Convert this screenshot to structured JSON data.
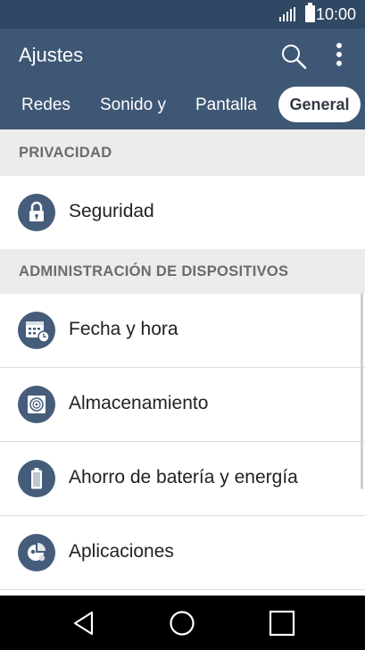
{
  "status": {
    "time": "10:00"
  },
  "app_bar": {
    "title": "Ajustes",
    "actions": [
      "search-icon",
      "more-vert-icon"
    ]
  },
  "tabs": [
    {
      "label": "Redes",
      "selected": false
    },
    {
      "label": "Sonido y",
      "selected": false
    },
    {
      "label": "Pantalla",
      "selected": false
    },
    {
      "label": "General",
      "selected": true
    }
  ],
  "sections": [
    {
      "header": "PRIVACIDAD",
      "items": [
        {
          "label": "Seguridad",
          "icon": "lock-icon"
        }
      ]
    },
    {
      "header": "ADMINISTRACIÓN DE DISPOSITIVOS",
      "items": [
        {
          "label": "Fecha y hora",
          "icon": "calendar-clock-icon"
        },
        {
          "label": "Almacenamiento",
          "icon": "storage-icon"
        },
        {
          "label": "Ahorro de batería y energía",
          "icon": "battery-icon"
        },
        {
          "label": "Aplicaciones",
          "icon": "apps-icon"
        }
      ]
    }
  ],
  "nav_bar": {
    "buttons": [
      "back-icon",
      "home-icon",
      "recents-icon"
    ]
  },
  "colors": {
    "status_bar": "#2f4863",
    "app_bar": "#3e5774",
    "section_header_bg": "#ececec",
    "icon_circle": "#455d7a"
  }
}
